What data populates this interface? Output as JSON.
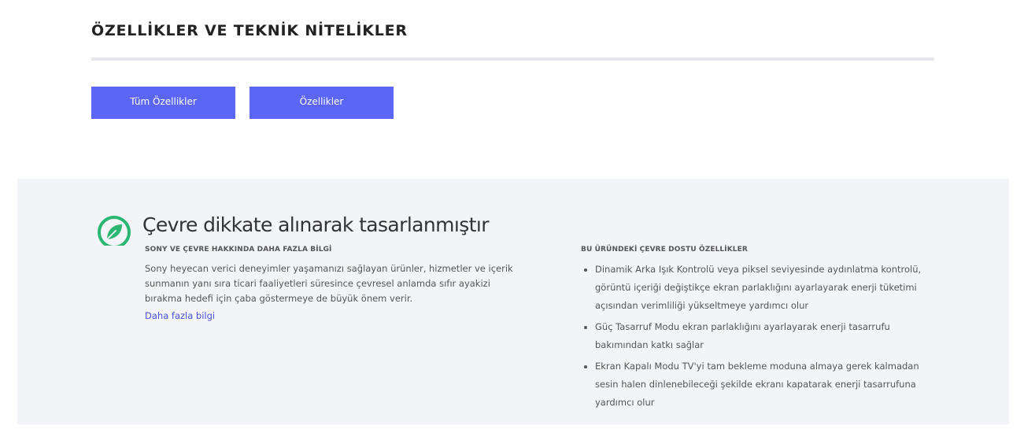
{
  "specs": {
    "title": "ÖZELLİKLER VE TEKNİK NİTELİKLER",
    "buttons": {
      "all_features": "Tüm Özellikler",
      "features": "Özellikler"
    }
  },
  "eco": {
    "heading": "Çevre dikkate alınarak tasarlanmıştır",
    "left": {
      "subheading": "SONY VE ÇEVRE HAKKINDA DAHA FAZLA BİLGİ",
      "description": "Sony heyecan verici deneyimler yaşamanızı sağlayan ürünler, hizmetler ve içerik sunmanın yanı sıra ticari faaliyetleri süresince çevresel anlamda sıfır ayakizi bırakma hedefi için çaba göstermeye de büyük önem verir.",
      "link": "Daha fazla bilgi"
    },
    "right": {
      "subheading": "BU ÜRÜNDEKİ ÇEVRE DOSTU ÖZELLİKLER",
      "items": [
        "Dinamik Arka Işık Kontrolü veya piksel seviyesinde aydınlatma kontrolü, görüntü içeriği değiştikçe ekran parlaklığını ayarlayarak enerji tüketimi açısından verimliliği yükseltmeye yardımcı olur",
        "Güç Tasarruf Modu ekran parlaklığını ayarlayarak enerji tasarrufu bakımından katkı sağlar",
        "Ekran Kapalı Modu TV'yi tam bekleme moduna almaya gerek kalmadan sesin halen dinlenebileceği şekilde ekranı kapatarak enerji tasarrufuna yardımcı olur"
      ]
    },
    "icon": "leaf-icon",
    "accent_color": "#2bb673"
  },
  "colors": {
    "button_bg": "#5b65f6",
    "panel_bg": "#f2f4f7",
    "link": "#4850d8"
  }
}
